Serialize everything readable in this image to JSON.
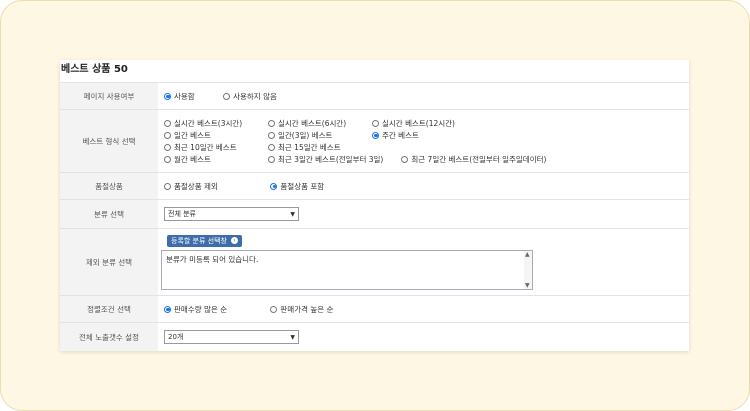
{
  "title": "베스트 상품 50",
  "rows": {
    "page_use": {
      "label": "페이지 사용여부",
      "options": [
        "사용함",
        "사용하지 않음"
      ]
    },
    "best_type": {
      "label": "베스트 형식 선택",
      "options": [
        "실시간 베스트(3시간)",
        "실시간 베스트(6시간)",
        "실시간 베스트(12시간)",
        "일간 베스트",
        "일간(3일) 베스트",
        "주간 베스트",
        "최근 10일간 베스트",
        "최근 15일간 베스트",
        "월간 베스트",
        "최근 3일간 베스트(전일부터 3일)",
        "최근 7일간 베스트(전일부터 일주일데이터)"
      ]
    },
    "soldout": {
      "label": "품절상품",
      "options": [
        "품절상품 제외",
        "품절상품 포함"
      ]
    },
    "category": {
      "label": "분류 선택",
      "value": "전체 분류"
    },
    "exclude": {
      "label": "제외 분류 선택",
      "button": "등록할 분류 선택창",
      "textarea": "분류가 미등록 되어 있습니다."
    },
    "sort": {
      "label": "정렬조건 선택",
      "options": [
        "판매수량 많은 순",
        "판매가격 높은 순"
      ]
    },
    "count": {
      "label": "전체 노출갯수 설정",
      "value": "20개"
    }
  }
}
